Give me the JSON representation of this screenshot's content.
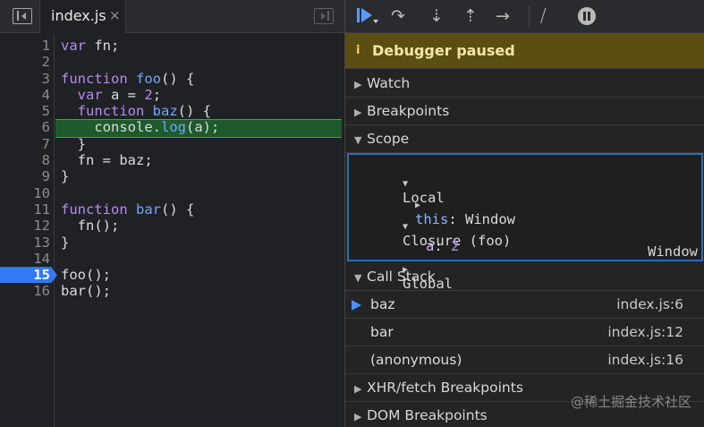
{
  "editor": {
    "tab_label": "index.js",
    "tab_close": "×",
    "lines": [
      {
        "n": "1",
        "tokens": [
          {
            "c": "kw",
            "t": "var"
          },
          {
            "c": "tx",
            "t": " fn;"
          }
        ]
      },
      {
        "n": "2",
        "tokens": []
      },
      {
        "n": "3",
        "tokens": [
          {
            "c": "kw",
            "t": "function"
          },
          {
            "c": "tx",
            "t": " "
          },
          {
            "c": "fn",
            "t": "foo"
          },
          {
            "c": "tx",
            "t": "() {"
          }
        ]
      },
      {
        "n": "4",
        "tokens": [
          {
            "c": "tx",
            "t": "  "
          },
          {
            "c": "kw",
            "t": "var"
          },
          {
            "c": "tx",
            "t": " a = "
          },
          {
            "c": "num",
            "t": "2"
          },
          {
            "c": "tx",
            "t": ";"
          }
        ]
      },
      {
        "n": "5",
        "tokens": [
          {
            "c": "tx",
            "t": "  "
          },
          {
            "c": "kw",
            "t": "function"
          },
          {
            "c": "tx",
            "t": " "
          },
          {
            "c": "fn",
            "t": "baz"
          },
          {
            "c": "tx",
            "t": "() {"
          }
        ]
      },
      {
        "n": "6",
        "tokens": [
          {
            "c": "tx",
            "t": "    console."
          },
          {
            "c": "fn",
            "t": "log"
          },
          {
            "c": "tx",
            "t": "(a);"
          }
        ],
        "highlight": true
      },
      {
        "n": "7",
        "tokens": [
          {
            "c": "tx",
            "t": "  }"
          }
        ]
      },
      {
        "n": "8",
        "tokens": [
          {
            "c": "tx",
            "t": "  fn = baz;"
          }
        ]
      },
      {
        "n": "9",
        "tokens": [
          {
            "c": "tx",
            "t": "}"
          }
        ]
      },
      {
        "n": "10",
        "tokens": []
      },
      {
        "n": "11",
        "tokens": [
          {
            "c": "kw",
            "t": "function"
          },
          {
            "c": "tx",
            "t": " "
          },
          {
            "c": "fn",
            "t": "bar"
          },
          {
            "c": "tx",
            "t": "() {"
          }
        ]
      },
      {
        "n": "12",
        "tokens": [
          {
            "c": "tx",
            "t": "  fn();"
          }
        ]
      },
      {
        "n": "13",
        "tokens": [
          {
            "c": "tx",
            "t": "}"
          }
        ]
      },
      {
        "n": "14",
        "tokens": []
      },
      {
        "n": "15",
        "tokens": [
          {
            "c": "tx",
            "t": "foo();"
          }
        ],
        "breakpoint": true
      },
      {
        "n": "16",
        "tokens": [
          {
            "c": "tx",
            "t": "bar();"
          }
        ]
      }
    ]
  },
  "toolbar": {
    "step_over_glyph": "↷",
    "step_into_glyph": "⇣",
    "step_out_glyph": "⇡",
    "step_glyph": "→",
    "deactivate_glyph": "⧸"
  },
  "paused": {
    "icon": "i",
    "text": "Debugger paused"
  },
  "sections": {
    "watch": "Watch",
    "breakpoints": "Breakpoints",
    "scope": "Scope",
    "call_stack": "Call Stack",
    "xhr": "XHR/fetch Breakpoints",
    "dom": "DOM Breakpoints"
  },
  "scope": {
    "local": "Local",
    "this_key": "this",
    "this_value": "Window",
    "closure": "Closure (foo)",
    "a_key": "a",
    "a_value": "2",
    "global": "Global",
    "global_value": "Window"
  },
  "call_stack": [
    {
      "name": "baz",
      "location": "index.js:6"
    },
    {
      "name": "bar",
      "location": "index.js:12"
    },
    {
      "name": "(anonymous)",
      "location": "index.js:16"
    }
  ],
  "watermark": "@稀土掘金技术社区",
  "colors": {
    "accent": "#3478f6",
    "paused_bg": "#5b4e12",
    "highlight": "#1f5a2d"
  },
  "icons": [
    "sidebar-toggle-icon",
    "debugger-toggle-icon",
    "resume-icon",
    "step-over-icon",
    "step-into-icon",
    "step-out-icon",
    "step-icon",
    "deactivate-breakpoints-icon",
    "pause-exceptions-icon",
    "info-icon",
    "current-frame-arrow-icon"
  ]
}
